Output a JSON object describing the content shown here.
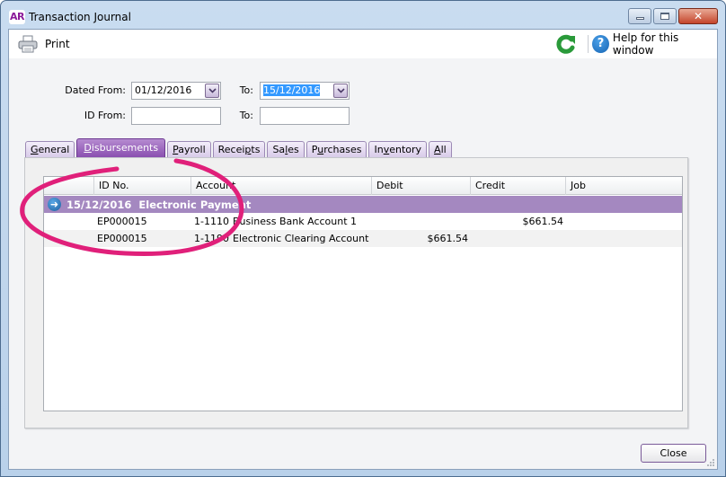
{
  "window": {
    "app_logo": "AR",
    "title": "Transaction Journal",
    "controls": {
      "minimize": "minimize",
      "maximize": "maximize",
      "close": "✕"
    }
  },
  "toolbar": {
    "print_label": "Print",
    "help_label": "Help for this window",
    "help_glyph": "?"
  },
  "filters": {
    "dated_from_label": "Dated From:",
    "dated_from_value": "01/12/2016",
    "dated_to_label": "To:",
    "dated_to_value": "15/12/2016",
    "id_from_label": "ID From:",
    "id_from_value": "",
    "id_to_label": "To:",
    "id_to_value": ""
  },
  "tabs": [
    {
      "label": "General",
      "mnemonic": "G",
      "rest": "eneral",
      "active": false
    },
    {
      "label": "Disbursements",
      "mnemonic": "D",
      "rest": "isbursements",
      "active": true
    },
    {
      "label": "Payroll",
      "mnemonic": "P",
      "rest": "ayroll",
      "active": false
    },
    {
      "label": "Receipts",
      "pre": "Recei",
      "mnemonic": "p",
      "rest": "ts",
      "active": false
    },
    {
      "label": "Sales",
      "pre": "Sa",
      "mnemonic": "l",
      "rest": "es",
      "active": false
    },
    {
      "label": "Purchases",
      "pre": "P",
      "mnemonic": "u",
      "rest": "rchases",
      "active": false
    },
    {
      "label": "Inventory",
      "pre": "In",
      "mnemonic": "v",
      "rest": "entory",
      "active": false
    },
    {
      "label": "All",
      "mnemonic": "A",
      "rest": "ll",
      "active": false
    }
  ],
  "grid": {
    "columns": [
      "",
      "ID No.",
      "Account",
      "Debit",
      "Credit",
      "Job"
    ],
    "group": {
      "date": "15/12/2016",
      "description": "Electronic Payment",
      "label": "15/12/2016  Electronic Payment"
    },
    "rows": [
      {
        "id": "EP000015",
        "account_no": "1-1110",
        "account_name": "Business Bank Account 1",
        "debit": "",
        "credit": "$661.54",
        "job": ""
      },
      {
        "id": "EP000015",
        "account_no": "1-1190",
        "account_name": "Electronic Clearing Account",
        "debit": "$661.54",
        "credit": "",
        "job": ""
      }
    ]
  },
  "footer": {
    "close_label": "Close"
  },
  "colors": {
    "accent_purple": "#8a4fb0",
    "group_row": "#a488c0",
    "annotation_pink": "#e0207a",
    "refresh_green": "#2a9a3a",
    "help_blue": "#1765b4"
  }
}
